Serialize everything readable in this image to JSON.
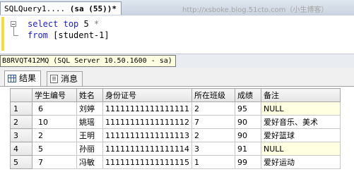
{
  "tab": {
    "title_prefix": "SQLQuery1....",
    "title_suffix": "(sa (55))*"
  },
  "watermark": "http://xsboke.blog.51cto.com（小生博客）",
  "editor": {
    "line1": {
      "kw1": "select",
      "kw2": "top",
      "num": "5",
      "star": "*"
    },
    "line2": {
      "kw": "from",
      "bracket": "[student-1]"
    }
  },
  "server_tip": "B8RVQT412MQ (SQL Server 10.50.1600 - sa)",
  "result_tabs": [
    {
      "label": "结果",
      "icon": "grid-icon"
    },
    {
      "label": "消息",
      "icon": "message-icon"
    }
  ],
  "columns": [
    "学生编号",
    "姓名",
    "身份证号",
    "所在班级",
    "成绩",
    "备注"
  ],
  "rows": [
    {
      "n": "1",
      "cells": [
        "6",
        "刘婷",
        "11111111111111111",
        "2",
        "95",
        "NULL"
      ]
    },
    {
      "n": "2",
      "cells": [
        "10",
        "姚瑶",
        "11111111111111112",
        "7",
        "90",
        "爱好音乐、美术"
      ]
    },
    {
      "n": "3",
      "cells": [
        "2",
        "王明",
        "11111111111111113",
        "2",
        "90",
        "爱好篮球"
      ]
    },
    {
      "n": "4",
      "cells": [
        "5",
        "孙丽",
        "11111111111111114",
        "3",
        "91",
        "NULL"
      ]
    },
    {
      "n": "5",
      "cells": [
        "7",
        "冯敏",
        "11111111111111115",
        "1",
        "99",
        "爱好运动"
      ]
    }
  ],
  "colors": {
    "keyword": "#1a1ad6",
    "null_cell_bg": "#ffffe1",
    "margin_marker": "#f0df3f"
  }
}
